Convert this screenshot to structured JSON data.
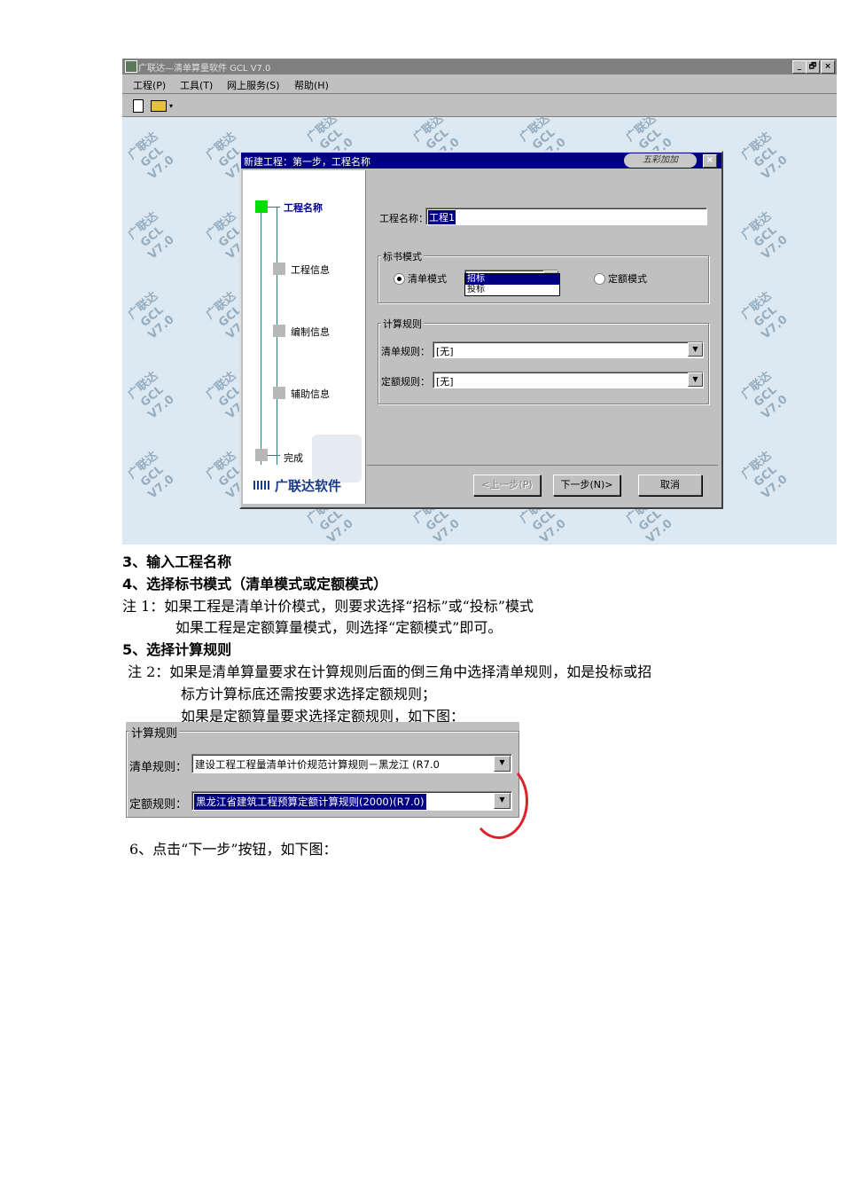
{
  "app": {
    "title": "广联达—清单算量软件 GCL V7.0",
    "window_buttons": [
      "_",
      "🗗",
      "×"
    ],
    "menu": [
      "工程(P)",
      "工具(T)",
      "网上服务(S)",
      "帮助(H)"
    ],
    "watermark": "广联达 GCL V7.0"
  },
  "dialog": {
    "title": "新建工程：第一步，工程名称",
    "logo": "五彩加加",
    "close": "×",
    "steps": [
      {
        "label": "工程名称",
        "active": true
      },
      {
        "label": "工程信息",
        "active": false
      },
      {
        "label": "编制信息",
        "active": false
      },
      {
        "label": "辅助信息",
        "active": false
      },
      {
        "label": "完成",
        "active": false
      }
    ],
    "brand": "广联达软件",
    "project_name_label": "工程名称：",
    "project_name_value": "工程1",
    "bid_mode_group": "标书模式",
    "bill_mode_label": "清单模式",
    "bill_mode_value": "招标",
    "bill_mode_options": [
      "招标",
      "投标"
    ],
    "quota_mode_label": "定额模式",
    "calc_rule_group": "计算规则",
    "bill_rule_label": "清单规则：",
    "bill_rule_value": "[无]",
    "quota_rule_label": "定额规则：",
    "quota_rule_value": "[无]",
    "prev_button": "<上一步(P)",
    "next_button": "下一步(N)>",
    "cancel_button": "取消"
  },
  "doc": {
    "step3": "3、输入工程名称",
    "step4": "4、选择标书模式（清单模式或定额模式）",
    "note1_line1": "注 1：如果工程是清单计价模式，则要求选择“招标”或“投标”模式",
    "note1_line2": "如果工程是定额算量模式，则选择“定额模式”即可。",
    "step5": "5、选择计算规则",
    "note2_line1": "注 2：如果是清单算量要求在计算规则后面的倒三角中选择清单规则，如是投标或招",
    "note2_line2": "标方计算标底还需按要求选择定额规则；",
    "note2_line3": "如果是定额算量要求选择定额规则，如下图：",
    "step6": "6、点击“下一步”按钮，如下图："
  },
  "snippet": {
    "group": "计算规则",
    "bill_rule_label": "清单规则：",
    "bill_rule_value": "建设工程工程量清单计价规范计算规则－黑龙江 (R7.0",
    "quota_rule_label": "定额规则：",
    "quota_rule_value": "黑龙江省建筑工程预算定额计算规则(2000)(R7.0)"
  }
}
